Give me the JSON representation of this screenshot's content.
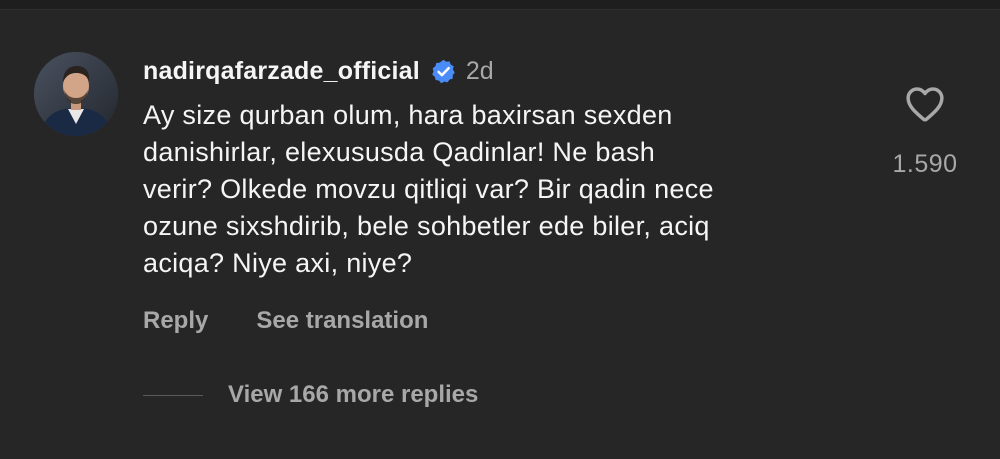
{
  "comment": {
    "username": "nadirqafarzade_official",
    "time_ago": "2d",
    "text": "Ay size qurban olum, hara baxirsan sexden\ndanishirlar, elexususda Qadinlar! Ne bash\nverir? Olkede movzu qitliqi var? Bir qadin nece\nozune sixshdirib, bele sohbetler ede biler, aciq\naciqa? Niye axi, niye?",
    "like_count": "1.590",
    "actions": {
      "reply_label": "Reply",
      "translate_label": "See translation"
    },
    "view_replies_label": "View 166 more replies"
  },
  "icons": {
    "verified": "verified-badge-icon",
    "like": "heart-icon"
  },
  "colors": {
    "background": "#262626",
    "text_primary": "#f5f5f5",
    "text_secondary": "#a8a8a8",
    "verified_blue": "#4a8cf7"
  }
}
